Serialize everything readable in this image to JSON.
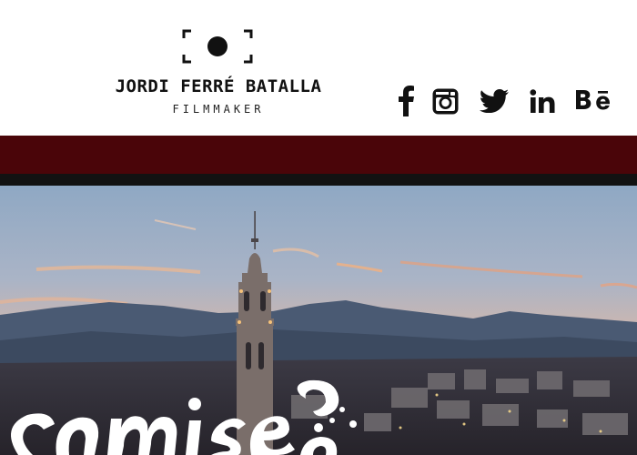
{
  "brand": {
    "name": "JORDI FERRÉ BATALLA",
    "tagline": "FILMMAKER"
  },
  "social_icons": [
    "facebook-icon",
    "instagram-icon",
    "twitter-icon",
    "linkedin-icon",
    "behance-icon"
  ],
  "social_glyphs": {
    "linkedin": "in",
    "behance": "Bē"
  },
  "colors": {
    "nav_bar": "#4a0509",
    "nav_strip": "#121212",
    "text": "#111111"
  }
}
